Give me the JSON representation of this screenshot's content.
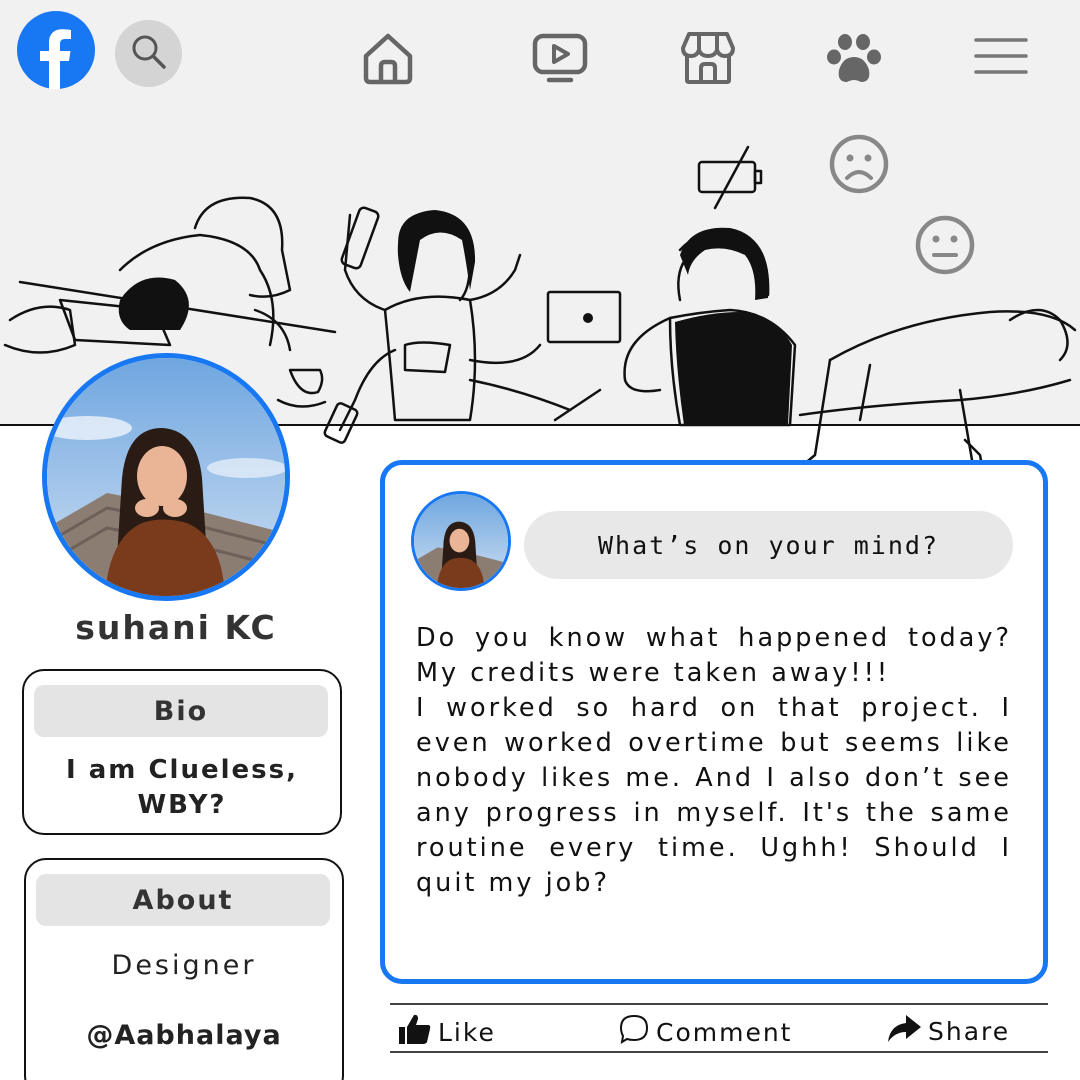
{
  "nav": {
    "logo_icon": "facebook-logo-icon",
    "search_icon": "search-icon",
    "items": [
      {
        "icon": "home-icon"
      },
      {
        "icon": "video-icon"
      },
      {
        "icon": "marketplace-icon"
      },
      {
        "icon": "groups-icon"
      },
      {
        "icon": "menu-icon"
      }
    ]
  },
  "accent_color": "#1877f2",
  "profile": {
    "name": "suhani KC"
  },
  "bio": {
    "heading": "Bio",
    "text": "I am Clueless, WBY?"
  },
  "about": {
    "heading": "About",
    "role": "Designer",
    "handle": "@Aabhalaya"
  },
  "composer": {
    "placeholder": "What’s on your mind?"
  },
  "post": {
    "paragraph1": "Do you know what happened today? My credits were taken away!!!",
    "paragraph2": "I worked so hard on that project. I even worked overtime but seems like nobody likes me. And I also don’t see any progress in myself. It's the same routine every time. Ughh! Should I quit my job?"
  },
  "actions": {
    "like": "Like",
    "comment": "Comment",
    "share": "Share"
  }
}
